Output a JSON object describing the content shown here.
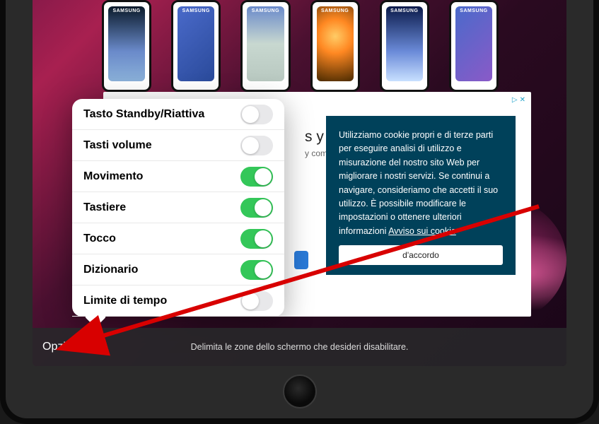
{
  "partial": {
    "line1": "s y ac",
    "line2": "y compon"
  },
  "cookie": {
    "text": "Utilizziamo cookie propri e di terze parti per eseguire analisi di utilizzo e misurazione del nostro sito Web per migliorare i nostri servizi. Se continui a navigare, consideriamo che accetti il suo utilizzo. È possibile modificare le impostazioni o ottenere ulteriori informazioni ",
    "link": "Avviso sui cookie",
    "accept": "d'accordo"
  },
  "ad": {
    "triangle": "▷",
    "x": "✕"
  },
  "popover": {
    "items": [
      {
        "label": "Tasto Standby/Riattiva",
        "on": false
      },
      {
        "label": "Tasti volume",
        "on": false
      },
      {
        "label": "Movimento",
        "on": true
      },
      {
        "label": "Tastiere",
        "on": true
      },
      {
        "label": "Tocco",
        "on": true
      },
      {
        "label": "Dizionario",
        "on": true
      },
      {
        "label": "Limite di tempo",
        "on": false
      }
    ]
  },
  "bottom": {
    "opzioni": "Opzioni",
    "instruction": "Delimita le zone dello schermo che desideri disabilitare."
  },
  "phones": {
    "brand": "SAMSUNG"
  }
}
